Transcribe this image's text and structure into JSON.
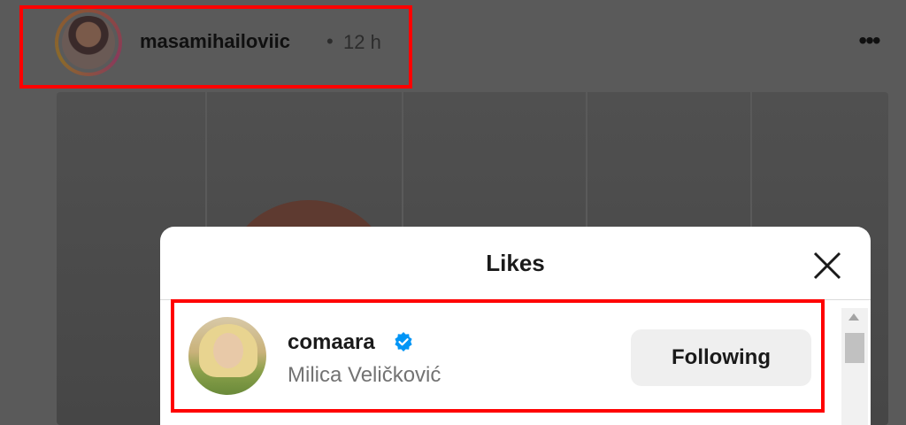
{
  "post": {
    "username": "masamihailoviic",
    "separator": "•",
    "time": "12 h",
    "more_label": "•••"
  },
  "modal": {
    "title": "Likes",
    "rows": [
      {
        "username": "comaara",
        "full_name": "Milica Veličković",
        "button_label": "Following",
        "verified": true
      }
    ]
  },
  "colors": {
    "highlight": "#ff0000",
    "verified_badge": "#0095f6",
    "overlay": "#5a5a5a"
  },
  "icons": [
    "more-options-icon",
    "close-icon",
    "verified-badge-icon",
    "scroll-up-arrow-icon"
  ]
}
